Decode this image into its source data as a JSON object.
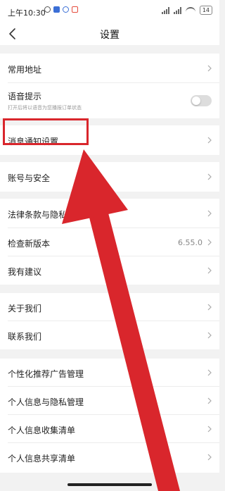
{
  "status_bar": {
    "time": "上午10:30",
    "battery": "14"
  },
  "header": {
    "title": "设置"
  },
  "settings": {
    "common_address": "常用地址",
    "voice_prompt": {
      "label": "语音提示",
      "desc": "打开后将以语音为您播报订单状态",
      "enabled": false
    },
    "notification_settings": "消息通知设置",
    "account_security": "账号与安全",
    "legal_privacy": "法律条款与隐私政策",
    "check_update": {
      "label": "检查新版本",
      "version": "6.55.0"
    },
    "suggestions": "我有建议",
    "about_us": "关于我们",
    "contact_us": "联系我们",
    "ad_management": "个性化推荐广告管理",
    "privacy_management": "个人信息与隐私管理",
    "info_collection": "个人信息收集清单",
    "info_sharing": "个人信息共享清单"
  },
  "colors": {
    "annotation_red": "#d9262c",
    "background": "#f2f2f2"
  }
}
